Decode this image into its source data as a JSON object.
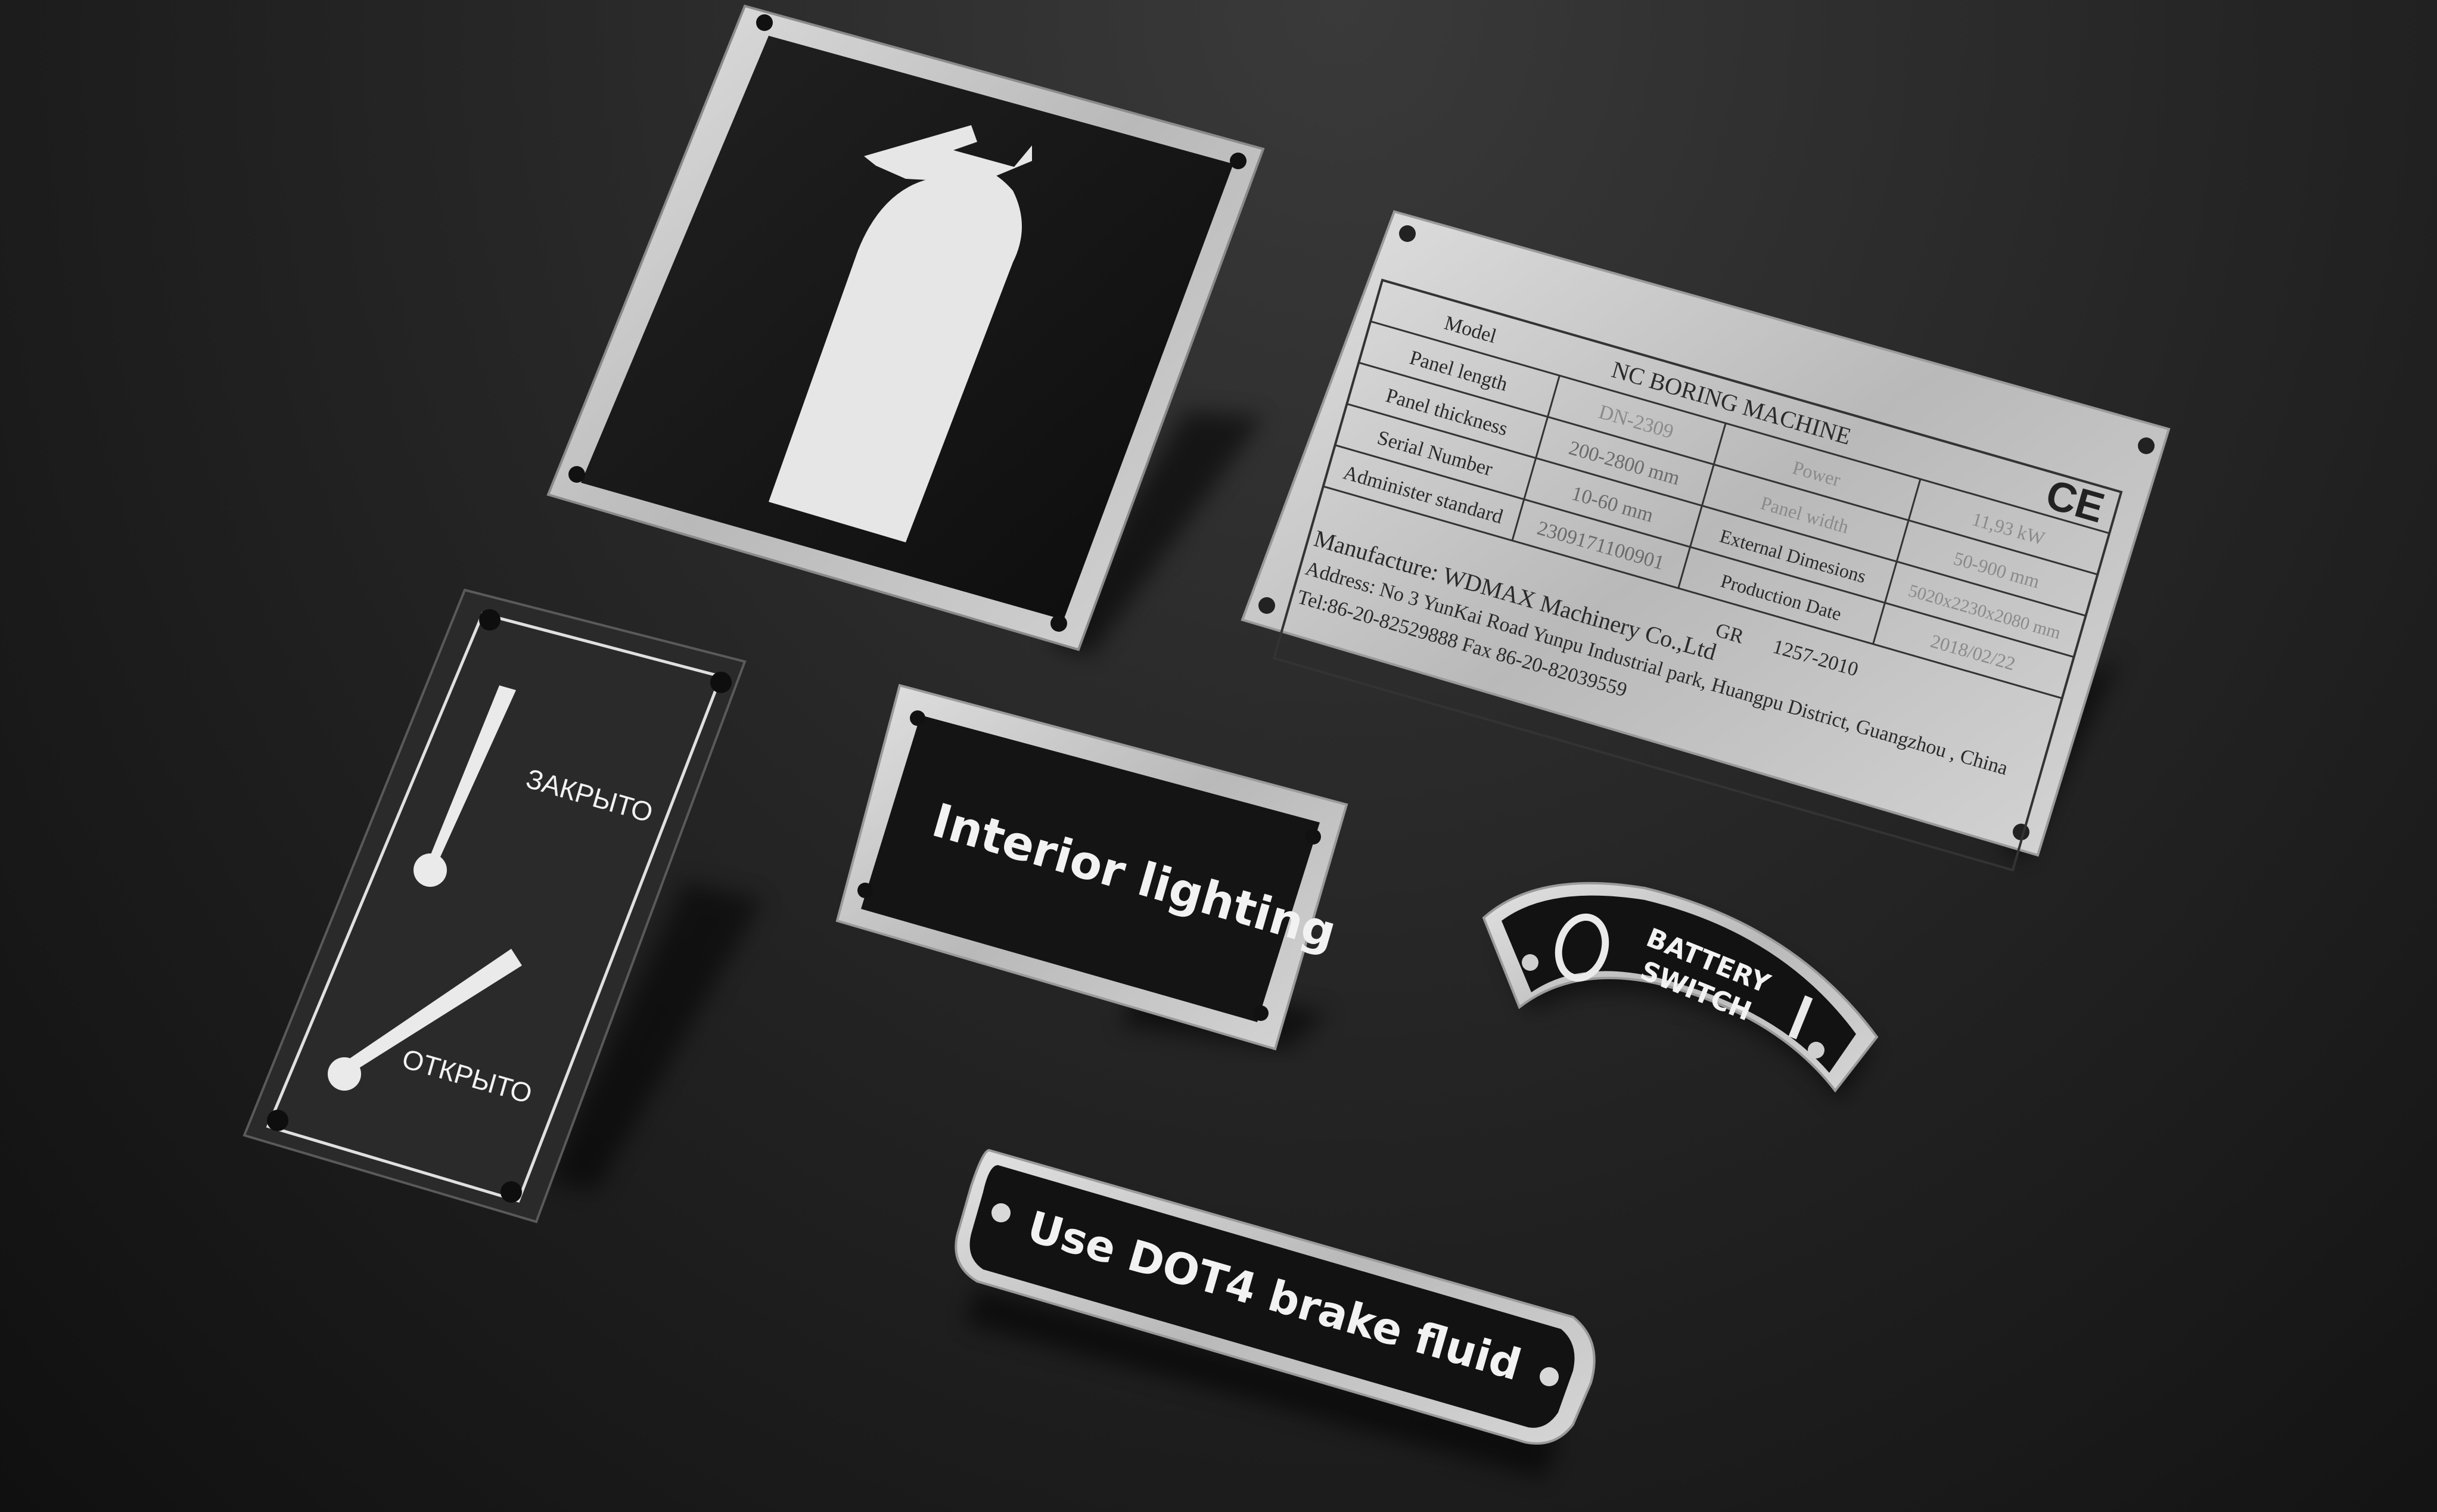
{
  "colors": {
    "background": "#1c1c1c",
    "steel": "#c8c8c8",
    "black_panel": "#121212",
    "etched_text": "#f2f2f2",
    "engraved_text": "#2a2a2a"
  },
  "fire_extinguisher_sign": {
    "icon": "fire-extinguisher-icon"
  },
  "valve_plate": {
    "closed_label": "ЗАКРЫТО",
    "open_label": "ОТКРЫТО"
  },
  "interior_plate": {
    "label": "Interior lighting"
  },
  "battery_plate": {
    "line1": "BATTERY",
    "line2": "SWITCH"
  },
  "brake_plate": {
    "label": "Use DOT4 brake fluid"
  },
  "nameplate": {
    "title": "NC BORING MACHINE",
    "ce_mark": "CE",
    "rows": [
      {
        "label": "Model",
        "value": "DN-2309"
      },
      {
        "label": "Panel length",
        "value": "200-2800 mm"
      },
      {
        "label": "Panel thickness",
        "value": "10-60 mm"
      },
      {
        "label": "Serial Number",
        "value": "2309171100901"
      },
      {
        "label": "Administer standard",
        "value": ""
      }
    ],
    "right_rows": [
      {
        "label": "Power",
        "value": "11,93 kW"
      },
      {
        "label": "Panel width",
        "value": "50-900 mm"
      },
      {
        "label": "External Dimesions",
        "value": "5020x2230x2080 mm"
      },
      {
        "label": "Production Date",
        "value": "2018/02/22"
      }
    ],
    "standard_code": "GR",
    "standard_value": "1257-2010",
    "manufacturer": "Manufacture: WDMAX Machinery Co.,Ltd",
    "address": "Address: No 3 YunKai Road Yunpu Industrial park, Huangpu District, Guangzhou , China",
    "contact": "Tel:86-20-82529888 Fax 86-20-82039559"
  }
}
